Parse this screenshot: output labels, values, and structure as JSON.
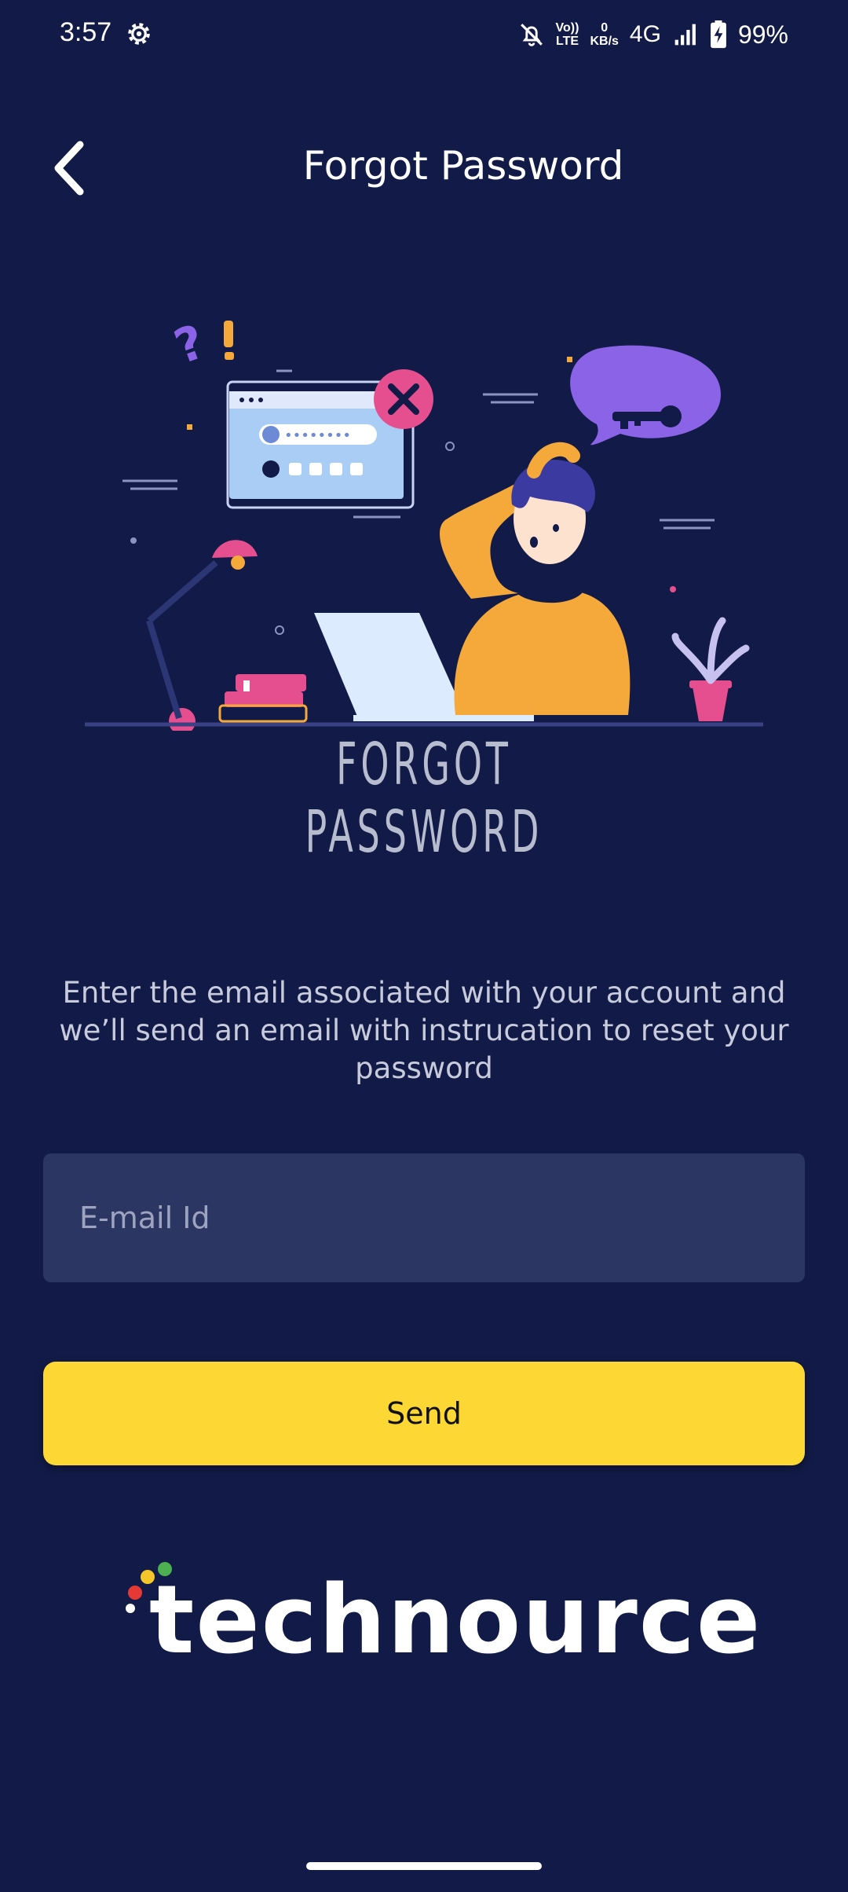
{
  "status_bar": {
    "time": "3:57",
    "volte_label_top": "Vo))",
    "volte_label_bottom": "LTE",
    "data_rate_value": "0",
    "data_rate_unit": "KB/s",
    "network_type": "4G",
    "battery_percent": "99%"
  },
  "header": {
    "title": "Forgot Password"
  },
  "illustration": {
    "caption": "FORGOT PASSWORD",
    "password_mask": "••••••••"
  },
  "description": "Enter the email associated with your account and we’ll send an email with instrucation to reset your password",
  "form": {
    "email_placeholder": "E-mail Id",
    "email_value": "",
    "send_label": "Send"
  },
  "logo": {
    "text": "technource"
  },
  "colors": {
    "background": "#121a47",
    "input_bg": "#2c3663",
    "accent_yellow": "#fdd835",
    "accent_pink": "#e64f8f",
    "accent_purple": "#8a63e6",
    "accent_orange": "#f5a93a"
  }
}
